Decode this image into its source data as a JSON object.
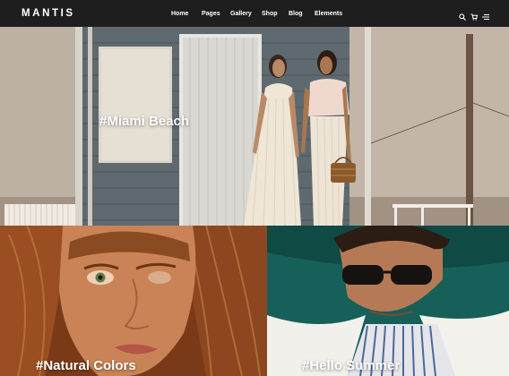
{
  "brand": {
    "logo": "MANTIS"
  },
  "nav": {
    "items": [
      "Home",
      "Pages",
      "Gallery",
      "Shop",
      "Blog",
      "Elements"
    ]
  },
  "header_icons": [
    "search-icon",
    "cart-icon",
    "menu-icon"
  ],
  "hero": {
    "caption": "#Miami Beach"
  },
  "tiles": [
    {
      "caption": "#Natural Colors"
    },
    {
      "caption": "#Hello Summer"
    }
  ],
  "colors": {
    "topbar": "#1e1e1e",
    "text": "#ffffff"
  }
}
